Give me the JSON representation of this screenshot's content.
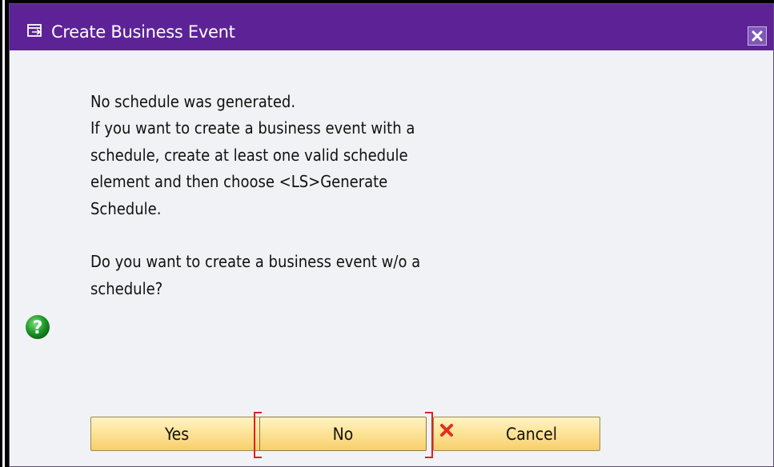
{
  "dialog": {
    "title": "Create Business Event",
    "title_icon": "dialog-window-icon",
    "close_icon": "close-icon"
  },
  "message": {
    "lines": [
      "No schedule was generated.",
      "If you want to create a business event with a",
      "schedule, create at least one valid schedule",
      "element and then choose <LS>Generate",
      "Schedule."
    ],
    "question_lines": [
      "Do you want to create a business event w/o a",
      "schedule?"
    ],
    "icon": "question-icon"
  },
  "buttons": {
    "yes": "Yes",
    "no": "No",
    "cancel": "Cancel",
    "cancel_icon": "red-x-icon",
    "focused": "No"
  },
  "colors": {
    "titlebar": "#5d2396",
    "dialog_background": "#f1f2f5",
    "button_gradient_top": "#fff3c4",
    "button_gradient_bottom": "#f7cf6b",
    "focus_marker": "#e02020",
    "question_icon": "#1f9a2a",
    "cancel_icon": "#e0301e"
  }
}
